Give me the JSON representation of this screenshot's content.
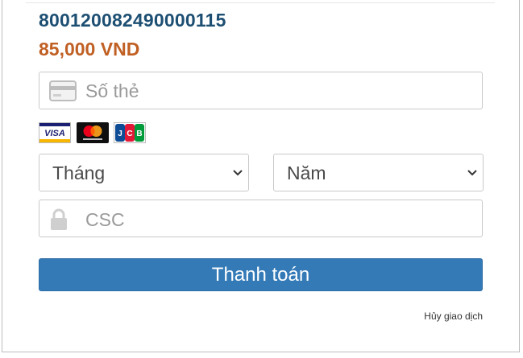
{
  "order": {
    "id": "800120082490000115",
    "amount": "85,000 VND"
  },
  "card_number": {
    "placeholder": "Số thẻ",
    "icon": "credit-card-icon"
  },
  "brands": [
    {
      "name": "VISA",
      "icon": "visa-logo"
    },
    {
      "name": "mastercard",
      "icon": "mastercard-logo"
    },
    {
      "name": "JCB",
      "icon": "jcb-logo"
    }
  ],
  "expiry": {
    "month_label": "Tháng",
    "year_label": "Năm"
  },
  "csc": {
    "placeholder": "CSC",
    "icon": "lock-icon"
  },
  "actions": {
    "pay_label": "Thanh toán",
    "cancel_label": "Hủy giao dịch"
  },
  "colors": {
    "order_id": "#1d4f73",
    "amount": "#c06024",
    "pay_button": "#337ab7"
  }
}
